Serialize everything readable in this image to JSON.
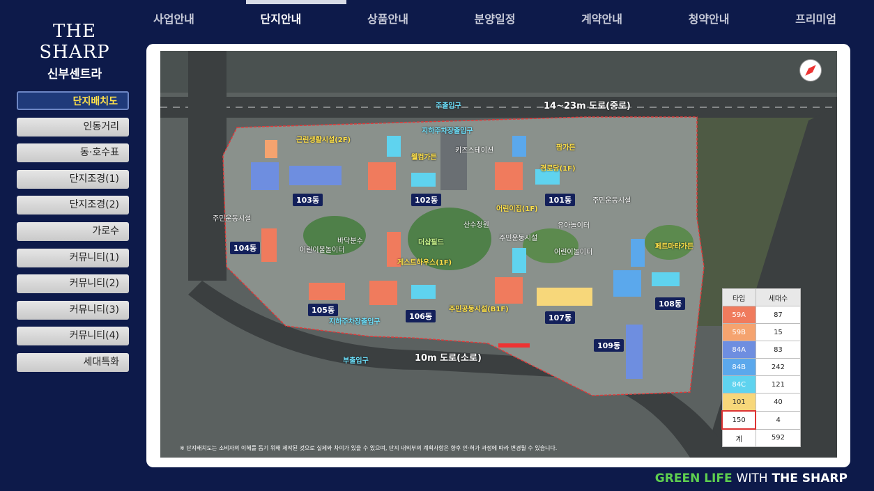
{
  "logo": {
    "title": "THE SHARP",
    "subtitle": "신부센트라"
  },
  "nav": [
    "사업안내",
    "단지안내",
    "상품안내",
    "분양일정",
    "계약안내",
    "청약안내",
    "프리미엄"
  ],
  "sidebar": [
    "단지배치도",
    "인동거리",
    "동·호수표",
    "단지조경(1)",
    "단지조경(2)",
    "가로수",
    "커뮤니티(1)",
    "커뮤니티(2)",
    "커뮤니티(3)",
    "커뮤니티(4)",
    "세대특화"
  ],
  "map": {
    "roads": {
      "north": "14~23m 도로(중로)",
      "south": "10m 도로(소로)"
    },
    "entrances": {
      "main": "주출입구",
      "underground_top": "지하주차장출입구",
      "underground_bottom": "지하주차장출입구",
      "sub": "부출입구"
    },
    "facilities": {
      "shops": "근린생활시설(2F)",
      "kids_station": "키즈스테이션",
      "welcome_garden": "웰컴가든",
      "palm_garden": "팜가든",
      "senior": "경로당(1F)",
      "daycare": "어린이집(1F)",
      "fitness_1": "주민운동시설",
      "fitness_2": "주민운동시설",
      "fitness_3": "주민운동시설",
      "water_play": "바닥분수",
      "kids_water": "어린이물놀이터",
      "the_sharp_field": "더샵필드",
      "guest_house": "게스트하우스(1F)",
      "landscape": "산수정원",
      "kindergarten": "유아놀이터",
      "playground": "어린이놀이터",
      "pet_garden": "페트마타가든",
      "community": "주민공동시설(B1F)"
    },
    "buildings": [
      "101동",
      "102동",
      "103동",
      "104동",
      "105동",
      "106동",
      "107동",
      "108동",
      "109동"
    ],
    "note": "※ 단지배치도는 소비자의 이해를 돕기 위해 제작된 것으로 실제와 차이가 있을 수 있으며, 단지 내외부의 계획사항은 향후 인·허가 과정에 따라 변경될 수 있습니다."
  },
  "legend": {
    "headers": [
      "타입",
      "세대수"
    ],
    "rows": [
      {
        "type": "59A",
        "count": "87",
        "color": "#f07b5d"
      },
      {
        "type": "59B",
        "count": "15",
        "color": "#f5a36f"
      },
      {
        "type": "84A",
        "count": "83",
        "color": "#6e8ee0"
      },
      {
        "type": "84B",
        "count": "242",
        "color": "#5ba8ec"
      },
      {
        "type": "84C",
        "count": "121",
        "color": "#5fd3ef"
      },
      {
        "type": "101",
        "count": "40",
        "color": "#f7d77a"
      },
      {
        "type": "150",
        "count": "4",
        "color": "#ffffff"
      },
      {
        "type": "계",
        "count": "592",
        "color": "#ffffff"
      }
    ]
  },
  "footer": {
    "green": "GREEN LIFE",
    "with": "WITH",
    "brand": "THE SHARP"
  }
}
